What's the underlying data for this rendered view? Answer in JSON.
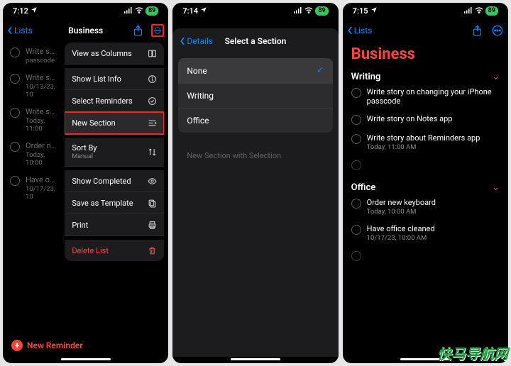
{
  "watermark": "快马导航网",
  "screen1": {
    "status": {
      "time": "7:12",
      "battery": "89"
    },
    "nav": {
      "back": "Lists",
      "title": "Business"
    },
    "reminders": [
      {
        "title": "Write story",
        "sub": "passcode"
      },
      {
        "title": "Write story",
        "sub": "10/13/23, 10"
      },
      {
        "title": "Write story",
        "sub": "Today, 11:00"
      },
      {
        "title": "Order new",
        "sub": "Today, 10:00"
      },
      {
        "title": "Have office",
        "sub": "10/17/23, 10"
      }
    ],
    "menu": {
      "view_columns": "View as Columns",
      "show_info": "Show List Info",
      "select_reminders": "Select Reminders",
      "new_section": "New Section",
      "sort_by": "Sort By",
      "sort_by_sub": "Manual",
      "show_completed": "Show Completed",
      "save_template": "Save as Template",
      "print": "Print",
      "delete_list": "Delete List"
    },
    "new_reminder": "New Reminder"
  },
  "screen2": {
    "status": {
      "time": "7:14",
      "battery": "89"
    },
    "nav": {
      "back": "Details",
      "title": "Select a Section"
    },
    "sections": {
      "none": "None",
      "writing": "Writing",
      "office": "Office"
    },
    "footer": "New Section with Selection"
  },
  "screen3": {
    "status": {
      "time": "7:15",
      "battery": "89"
    },
    "nav": {
      "back": "Lists"
    },
    "title": "Business",
    "sections": [
      {
        "name": "Writing",
        "items": [
          {
            "title": "Write story on changing your iPhone passcode",
            "sub": ""
          },
          {
            "title": "Write story on Notes app",
            "sub": ""
          },
          {
            "title": "Write story about Reminders app",
            "sub": "Today, 11:00 AM"
          }
        ]
      },
      {
        "name": "Office",
        "items": [
          {
            "title": "Order new keyboard",
            "sub": "Today, 10:00 AM"
          },
          {
            "title": "Have office cleaned",
            "sub": "10/17/23, 10:00 AM"
          }
        ]
      }
    ]
  }
}
